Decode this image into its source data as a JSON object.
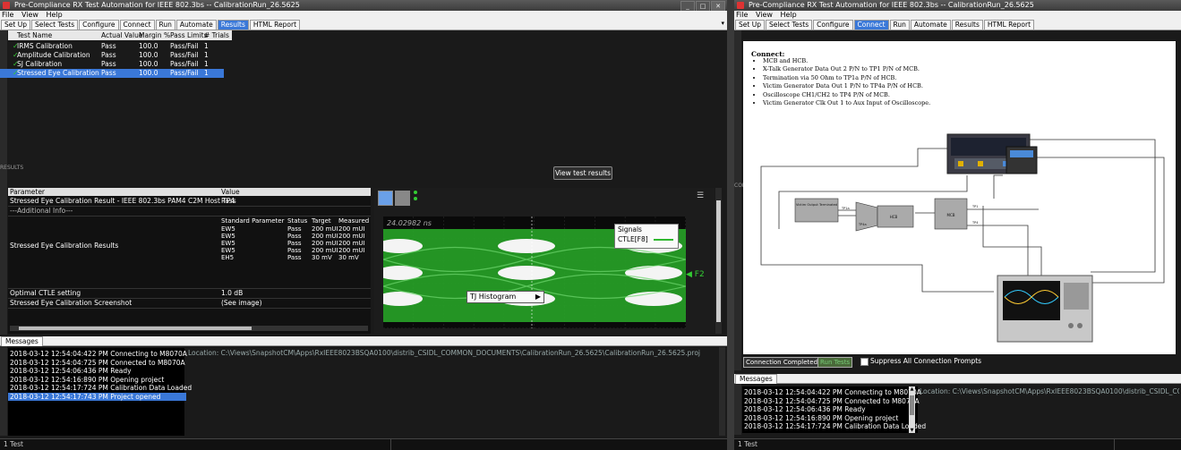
{
  "left_window": {
    "title": "Pre-Compliance RX Test Automation for IEEE 802.3bs -- CalibrationRun_26.5625",
    "menu": [
      "File",
      "View",
      "Help"
    ],
    "tabs": [
      "Set Up",
      "Select Tests",
      "Configure",
      "Connect",
      "Run",
      "Automate",
      "Results",
      "HTML Report"
    ],
    "active_tab": "Results",
    "side_label_top": "RESULTS",
    "results": {
      "headers": [
        "Test Name",
        "Actual Value",
        "Margin %",
        "Pass Limits",
        "# Trials"
      ],
      "rows": [
        [
          "IRMS Calibration",
          "Pass",
          "100.0",
          "Pass/Fail",
          "1"
        ],
        [
          "Amplitude Calibration",
          "Pass",
          "100.0",
          "Pass/Fail",
          "1"
        ],
        [
          "SJ Calibration",
          "Pass",
          "100.0",
          "Pass/Fail",
          "1"
        ],
        [
          "Stressed Eye Calibration",
          "Pass",
          "100.0",
          "Pass/Fail",
          "1"
        ]
      ]
    },
    "view_results_button": "View test results",
    "params": {
      "header_param": "Parameter",
      "header_value": "Value",
      "result_title": "Stressed Eye Calibration Result - IEEE 802.3bs PAM4 C2M Host TP4",
      "result_value": "Pass",
      "additional_info": "---Additional Info---",
      "results_label": "Stressed Eye Calibration Results",
      "std_headers": [
        "Standard Parameter",
        "Status",
        "Target",
        "Measured"
      ],
      "std_rows": [
        [
          "EW5",
          "Pass",
          "200 mUI",
          "200 mUI"
        ],
        [
          "EW5",
          "Pass",
          "200 mUI",
          "200 mUI"
        ],
        [
          "EW5",
          "Pass",
          "200 mUI",
          "200 mUI"
        ],
        [
          "EW5",
          "Pass",
          "200 mUI",
          "200 mUI"
        ],
        [
          "EH5",
          "Pass",
          "30 mV",
          "30 mV"
        ]
      ],
      "ctle_label": "Optimal CTLE setting",
      "ctle_value": "1.0 dB",
      "screenshot_label": "Stressed Eye Calibration Screenshot",
      "screenshot_value": "(See image)"
    },
    "eye": {
      "time_label": "24.02982 ns",
      "signals_title": "Signals",
      "signal_name": "CTLE[F8]",
      "tj_label": "TJ Histogram",
      "marker_label": "F2"
    },
    "messages": {
      "tab": "Messages",
      "items": [
        "2018-03-12 12:54:04:422 PM Connecting to M8070A",
        "2018-03-12 12:54:04:725 PM Connected to M8070A",
        "2018-03-12 12:54:06:436 PM Ready",
        "2018-03-12 12:54:16:890 PM Opening project",
        "2018-03-12 12:54:17:724 PM Calibration Data Loaded",
        "2018-03-12 12:54:17:743 PM Project opened"
      ],
      "selected_index": 5,
      "location": "Location: C:\\Views\\SnapshotCM\\Apps\\RxIEEE8023BSQA0100\\distrib_CSIDL_COMMON_DOCUMENTS\\CalibrationRun_26.5625\\CalibrationRun_26.5625.proj"
    },
    "status": "1 Test",
    "colors": {
      "accent": "#3a78d8",
      "pass_check": "#33cc33",
      "eye_green": "#2fb82f"
    }
  },
  "right_window": {
    "title": "Pre-Compliance RX Test Automation for IEEE 802.3bs -- CalibrationRun_26.5625",
    "menu": [
      "File",
      "View",
      "Help"
    ],
    "tabs": [
      "Set Up",
      "Select Tests",
      "Configure",
      "Connect",
      "Run",
      "Automate",
      "Results",
      "HTML Report"
    ],
    "active_tab": "Connect",
    "side_label": "CONNECT",
    "connect": {
      "heading": "Connect:",
      "steps": [
        "MCB and HCB.",
        "X-Talk Generator Data Out 2 P/N to TP1 P/N of MCB.",
        "Termination via 50 Ohm to TP1a P/N of HCB.",
        "Victim Generator Data Out 1 P/N to TP4a P/N of HCB.",
        "Oscilloscope CH1/CH2 to TP4 P/N of MCB.",
        "Victim Generator Clk Out 1 to Aux Input of Oscilloscope."
      ],
      "diagram": {
        "box_label": "Victim Output Terminated",
        "hcb": "HCB",
        "mcb": "MCB",
        "tp1": "TP1",
        "tp1a": "TP1a",
        "tp4": "TP4",
        "tp4a": "TP4a"
      },
      "btn_completed": "Connection Completed",
      "btn_run": "Run Tests",
      "suppress_label": "Suppress All Connection Prompts"
    },
    "messages": {
      "tab": "Messages",
      "items": [
        "2018-03-12 12:54:04:422 PM Connecting to M8070A",
        "2018-03-12 12:54:04:725 PM Connected to M8070A",
        "2018-03-12 12:54:06:436 PM Ready",
        "2018-03-12 12:54:16:890 PM Opening project",
        "2018-03-12 12:54:17:724 PM Calibration Data Loaded"
      ],
      "location": "Location: C:\\Views\\SnapshotCM\\Apps\\RxIEEE8023BSQA0100\\distrib_CSIDL_COMMON"
    },
    "status": "1 Test"
  }
}
